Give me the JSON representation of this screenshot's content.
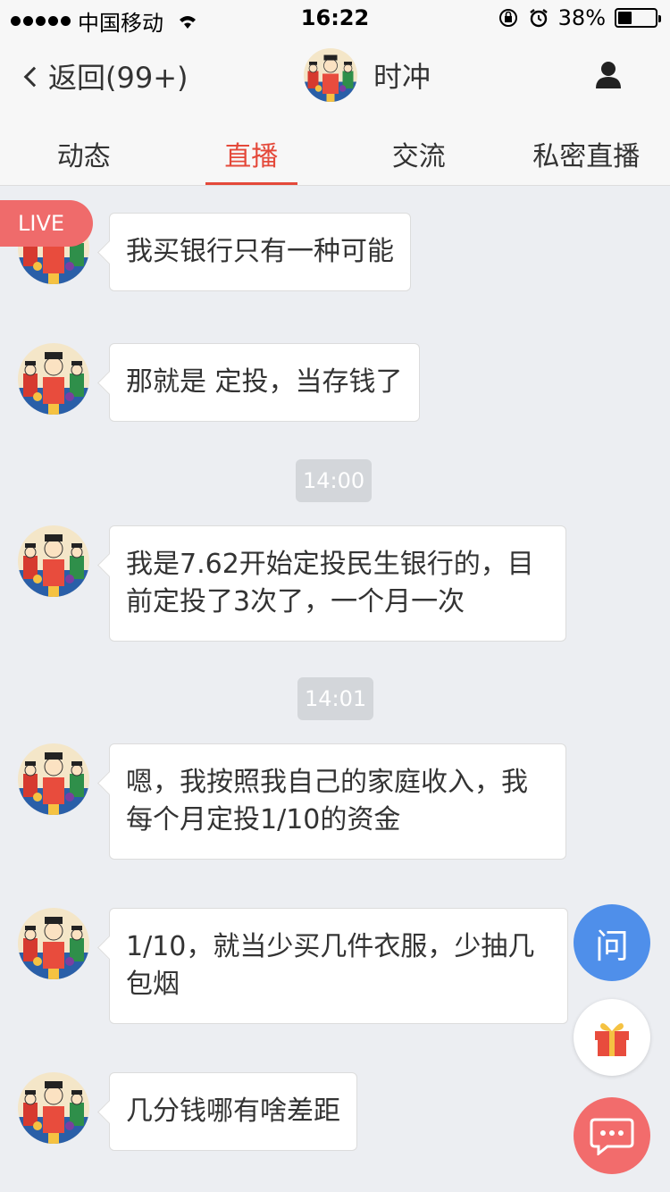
{
  "status_bar": {
    "carrier": "中国移动",
    "time": "16:22",
    "battery": "38%",
    "battery_level": 0.38
  },
  "nav": {
    "back_label": "返回(99+)",
    "title": "时冲"
  },
  "tabs": [
    {
      "label": "动态",
      "active": false
    },
    {
      "label": "直播",
      "active": true
    },
    {
      "label": "交流",
      "active": false
    },
    {
      "label": "私密直播",
      "active": false
    }
  ],
  "live_label": "LIVE",
  "messages": [
    {
      "text": "我买银行只有一种可能"
    },
    {
      "text": "那就是 定投，当存钱了"
    },
    {
      "text": "我是7.62开始定投民生银行的，目前定投了3次了，一个月一次"
    },
    {
      "text": "嗯，我按照我自己的家庭收入，我每个月定投1/10的资金"
    },
    {
      "text": "1/10，就当少买几件衣服，少抽几包烟"
    },
    {
      "text": "几分钱哪有啥差距"
    }
  ],
  "timestamps": [
    "14:00",
    "14:01"
  ],
  "fabs": {
    "ask_label": "问"
  },
  "colors": {
    "accent": "#e4493a",
    "ask_button": "#4f8fea",
    "chat_button": "#f26c6c",
    "live_badge": "#ef6b6b"
  }
}
